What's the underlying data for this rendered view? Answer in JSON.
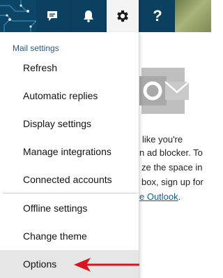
{
  "topbar": {
    "buttons": [
      {
        "icon": "chat-icon"
      },
      {
        "icon": "bell-icon"
      },
      {
        "icon": "gear-icon",
        "active": true
      },
      {
        "icon": "help-icon",
        "glyph": "?"
      }
    ],
    "colors": {
      "bar": "#0a3d5c",
      "active_bg": "#f4f4f4"
    }
  },
  "menu": {
    "header": "Mail settings",
    "items": [
      {
        "label": "Refresh"
      },
      {
        "label": "Automatic replies"
      },
      {
        "label": "Display settings"
      },
      {
        "label": "Manage integrations"
      },
      {
        "label": "Connected accounts"
      },
      {
        "label": "Offline settings"
      },
      {
        "label": "Change theme"
      },
      {
        "label": "Options",
        "highlighted": true
      }
    ]
  },
  "background_text": {
    "line1": "like you're",
    "line2": "n ad blocker. To",
    "line3": "ze the space in",
    "line4": "box, sign up for",
    "line5_link": "e Outlook",
    "line5_tail": "."
  },
  "annotation": {
    "arrow_color": "#d9141c"
  }
}
